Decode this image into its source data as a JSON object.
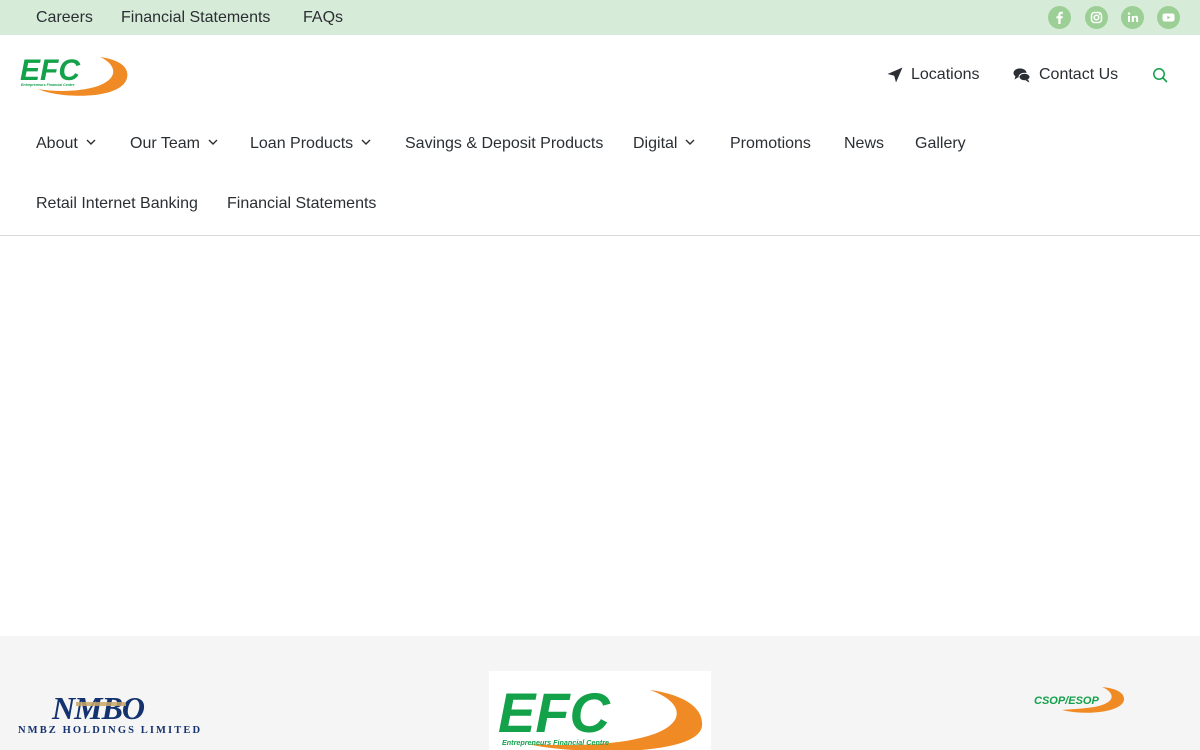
{
  "topbar": {
    "links": [
      "Careers",
      "Financial Statements",
      "FAQs"
    ],
    "social": [
      "facebook-icon",
      "instagram-icon",
      "linkedin-icon",
      "youtube-icon"
    ]
  },
  "header": {
    "logo_text": "EFC",
    "logo_tagline": "Entrepreneurs Financial Centre",
    "locations_label": "Locations",
    "contact_label": "Contact Us"
  },
  "nav": {
    "items": [
      {
        "label": "About",
        "dropdown": true
      },
      {
        "label": "Our Team",
        "dropdown": true
      },
      {
        "label": "Loan Products",
        "dropdown": true
      },
      {
        "label": "Savings & Deposit Products",
        "dropdown": false
      },
      {
        "label": "Digital",
        "dropdown": true
      },
      {
        "label": "Promotions",
        "dropdown": false
      },
      {
        "label": "News",
        "dropdown": false
      },
      {
        "label": "Gallery",
        "dropdown": false
      },
      {
        "label": "Retail Internet Banking",
        "dropdown": false
      },
      {
        "label": "Financial Statements",
        "dropdown": false
      }
    ]
  },
  "footer": {
    "nmbz_mark": "NMBO",
    "nmbz_name": "NMBZ HOLDINGS LIMITED",
    "efc_text": "EFC",
    "efc_tagline": "Entrepreneurs Financial Centre",
    "csop_text": "CSOP/ESOP"
  },
  "colors": {
    "brand_green": "#13a14a",
    "brand_orange": "#f08a24",
    "topbar_bg": "#d7ebd9",
    "social_bg": "#9ccf95",
    "footer_bg": "#f5f5f5",
    "nmbz_blue": "#14336e",
    "nmbz_gold": "#c9a86a"
  }
}
